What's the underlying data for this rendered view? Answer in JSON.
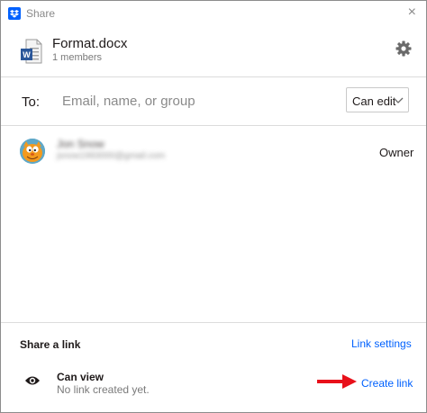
{
  "window": {
    "title": "Share",
    "close_glyph": "×"
  },
  "file": {
    "name": "Format.docx",
    "members": "1 members",
    "icon": "word-document-icon"
  },
  "share_to": {
    "label": "To:",
    "placeholder": "Email, name, or group",
    "permission": "Can edit"
  },
  "members": [
    {
      "name": "Jon Snow",
      "email": "jsnow1993000@gmail.com",
      "role": "Owner",
      "avatar": "cartoon-cat-avatar"
    }
  ],
  "share_link": {
    "title": "Share a link",
    "settings_label": "Link settings",
    "access": "Can view",
    "status": "No link created yet.",
    "create_label": "Create link"
  },
  "colors": {
    "accent": "#0061fe",
    "arrow": "#e8101a",
    "border": "#dcdcdc"
  }
}
